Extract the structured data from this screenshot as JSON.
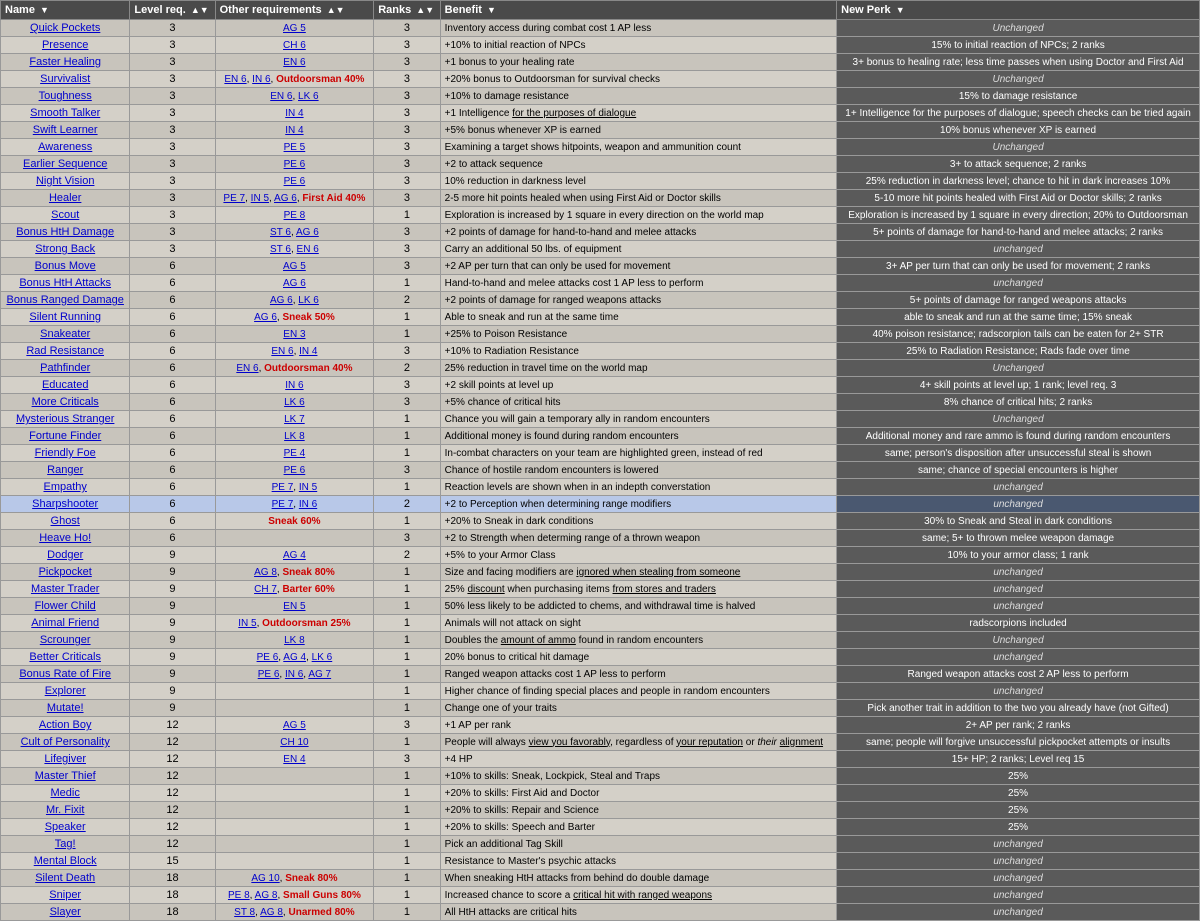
{
  "headers": [
    {
      "label": "Name",
      "key": "name"
    },
    {
      "label": "Level req.",
      "key": "level"
    },
    {
      "label": "Other requirements",
      "key": "other"
    },
    {
      "label": "Ranks",
      "key": "ranks"
    },
    {
      "label": "Benefit",
      "key": "benefit"
    },
    {
      "label": "New Perk",
      "key": "newperk"
    }
  ],
  "rows": [
    {
      "name": "Quick Pockets",
      "level": 3,
      "other": "AG 5",
      "other_raw": "AG 5",
      "ranks": 3,
      "benefit": "Inventory access during combat cost 1 AP less",
      "newperk": "Unchanged",
      "newperk_type": "unchanged"
    },
    {
      "name": "Presence",
      "level": 3,
      "other": "CH 6",
      "other_raw": "CH 6",
      "ranks": 3,
      "benefit": "+10% to initial reaction of NPCs",
      "newperk": "15% to initial reaction of NPCs; 2 ranks",
      "newperk_type": "changed"
    },
    {
      "name": "Faster Healing",
      "level": 3,
      "other": "EN 6",
      "other_raw": "EN 6",
      "ranks": 3,
      "benefit": "+1 bonus to your healing rate",
      "newperk": "3+ bonus to healing rate; less time passes when using Doctor and First Aid",
      "newperk_type": "changed"
    },
    {
      "name": "Survivalist",
      "level": 3,
      "other": "EN 6, IN 6, Outdoorsman 40%",
      "other_raw": "EN 6, IN 6, Outdoorsman 40%",
      "ranks": 3,
      "benefit": "+20% bonus to Outdoorsman for survival checks",
      "newperk": "Unchanged",
      "newperk_type": "unchanged"
    },
    {
      "name": "Toughness",
      "level": 3,
      "other": "EN 6, LK 6",
      "other_raw": "EN 6, LK 6",
      "ranks": 3,
      "benefit": "+10% to damage resistance",
      "newperk": "15% to damage resistance",
      "newperk_type": "changed"
    },
    {
      "name": "Smooth Talker",
      "level": 3,
      "other": "IN 4",
      "other_raw": "IN 4",
      "ranks": 3,
      "benefit": "+1 Intelligence for the purposes of dialogue",
      "newperk": "1+ Intelligence for the purposes of dialogue; speech checks can be tried again",
      "newperk_type": "changed"
    },
    {
      "name": "Swift Learner",
      "level": 3,
      "other": "IN 4",
      "other_raw": "IN 4",
      "ranks": 3,
      "benefit": "+5% bonus whenever XP is earned",
      "newperk": "10% bonus whenever XP is earned",
      "newperk_type": "changed"
    },
    {
      "name": "Awareness",
      "level": 3,
      "other": "PE 5",
      "other_raw": "PE 5",
      "ranks": 3,
      "benefit": "Examining a target shows hitpoints, weapon and ammunition count",
      "newperk": "",
      "newperk_type": "unchanged"
    },
    {
      "name": "Earlier Sequence",
      "level": 3,
      "other": "PE 6",
      "other_raw": "PE 6",
      "ranks": 3,
      "benefit": "+2 to attack sequence",
      "newperk": "3+ to attack sequence; 2 ranks",
      "newperk_type": "changed"
    },
    {
      "name": "Night Vision",
      "level": 3,
      "other": "PE 6",
      "other_raw": "PE 6",
      "ranks": 3,
      "benefit": "10% reduction in darkness level",
      "newperk": "25% reduction in darkness level; chance to hit in dark increases 10%",
      "newperk_type": "changed"
    },
    {
      "name": "Healer",
      "level": 3,
      "other": "PE 7, IN 5, AG 6, First Aid 40%",
      "other_raw": "PE 7, IN 5, AG 6, First Aid 40%",
      "ranks": 3,
      "benefit": "2-5 more hit points healed when using First Aid or Doctor skills",
      "newperk": "5-10 more hit points healed with First Aid or Doctor skills; 2 ranks",
      "newperk_type": "changed"
    },
    {
      "name": "Scout",
      "level": 3,
      "other": "PE 8",
      "other_raw": "PE 8",
      "ranks": 1,
      "benefit": "Exploration is increased by 1 square in every direction on the world map",
      "newperk": "Exploration is increased by 1 square in every direction; 20% to Outdoorsman",
      "newperk_type": "changed"
    },
    {
      "name": "Bonus HtH Damage",
      "level": 3,
      "other": "ST 6, AG 6",
      "other_raw": "ST 6, AG 6",
      "ranks": 3,
      "benefit": "+2 points of damage for hand-to-hand and melee attacks",
      "newperk": "5+ points of damage for hand-to-hand and melee attacks; 2 ranks",
      "newperk_type": "changed"
    },
    {
      "name": "Strong Back",
      "level": 3,
      "other": "ST 6, EN 6",
      "other_raw": "ST 6, EN 6",
      "ranks": 3,
      "benefit": "Carry an additional 50 lbs. of equipment",
      "newperk": "unchanged",
      "newperk_type": "unchanged"
    },
    {
      "name": "Bonus Move",
      "level": 6,
      "other": "AG 5",
      "other_raw": "AG 5",
      "ranks": 3,
      "benefit": "+2 AP per turn that can only be used for movement",
      "newperk": "3+ AP per turn that can only be used for movement; 2 ranks",
      "newperk_type": "changed"
    },
    {
      "name": "Bonus HtH Attacks",
      "level": 6,
      "other": "AG 6",
      "other_raw": "AG 6",
      "ranks": 1,
      "benefit": "Hand-to-hand and melee attacks cost 1 AP less to perform",
      "newperk": "unchanged",
      "newperk_type": "unchanged"
    },
    {
      "name": "Bonus Ranged Damage",
      "level": 6,
      "other": "AG 6, LK 6",
      "other_raw": "AG 6, LK 6",
      "ranks": 2,
      "benefit": "+2 points of damage for ranged weapons attacks",
      "newperk": "5+ points of damage for ranged weapons attacks",
      "newperk_type": "changed"
    },
    {
      "name": "Silent Running",
      "level": 6,
      "other": "AG 6, Sneak 50%",
      "other_raw": "AG 6, Sneak 50%",
      "ranks": 1,
      "benefit": "Able to sneak and run at the same time",
      "newperk": "able to sneak and run at the same time; 15% sneak",
      "newperk_type": "changed"
    },
    {
      "name": "Snakeater",
      "level": 6,
      "other": "EN 3",
      "other_raw": "EN 3",
      "ranks": 1,
      "benefit": "+25% to Poison Resistance",
      "newperk": "40% poison resistance; radscorpion tails can be eaten for 2+ STR",
      "newperk_type": "changed"
    },
    {
      "name": "Rad Resistance",
      "level": 6,
      "other": "EN 6, IN 4",
      "other_raw": "EN 6, IN 4",
      "ranks": 3,
      "benefit": "+10% to Radiation Resistance",
      "newperk": "25% to Radiation Resistance; Rads fade over time",
      "newperk_type": "changed"
    },
    {
      "name": "Pathfinder",
      "level": 6,
      "other": "EN 6, Outdoorsman 40%",
      "other_raw": "EN 6, Outdoorsman 40%",
      "ranks": 2,
      "benefit": "25% reduction in travel time on the world map",
      "newperk": "Unchanged",
      "newperk_type": "unchanged"
    },
    {
      "name": "Educated",
      "level": 6,
      "other": "IN 6",
      "other_raw": "IN 6",
      "ranks": 3,
      "benefit": "+2 skill points at level up",
      "newperk": "4+ skill points at level up; 1 rank; level req. 3",
      "newperk_type": "changed"
    },
    {
      "name": "More Criticals",
      "level": 6,
      "other": "LK 6",
      "other_raw": "LK 6",
      "ranks": 3,
      "benefit": "+5% chance of critical hits",
      "newperk": "8% chance of critical hits; 2 ranks",
      "newperk_type": "changed"
    },
    {
      "name": "Mysterious Stranger",
      "level": 6,
      "other": "LK 7",
      "other_raw": "LK 7",
      "ranks": 1,
      "benefit": "Chance you will gain a temporary ally in random encounters",
      "newperk": "Unchanged",
      "newperk_type": "unchanged"
    },
    {
      "name": "Fortune Finder",
      "level": 6,
      "other": "LK 8",
      "other_raw": "LK 8",
      "ranks": 1,
      "benefit": "Additional money is found during random encounters",
      "newperk": "Additional money and rare ammo is found during random encounters",
      "newperk_type": "changed"
    },
    {
      "name": "Friendly Foe",
      "level": 6,
      "other": "PE 4",
      "other_raw": "PE 4",
      "ranks": 1,
      "benefit": "In-combat characters on your team are highlighted green, instead of red",
      "newperk": "same; person's disposition after unsuccessful steal is shown",
      "newperk_type": "changed"
    },
    {
      "name": "Ranger",
      "level": 6,
      "other": "PE 6",
      "other_raw": "PE 6",
      "ranks": 3,
      "benefit": "Chance of hostile random encounters is lowered",
      "newperk": "same; chance of special encounters is higher",
      "newperk_type": "changed"
    },
    {
      "name": "Empathy",
      "level": 6,
      "other": "PE 7, IN 5",
      "other_raw": "PE 7, IN 5",
      "ranks": 1,
      "benefit": "Reaction levels are shown when in an indepth converstation",
      "newperk": "unchanged",
      "newperk_type": "unchanged"
    },
    {
      "name": "Sharpshooter",
      "level": 6,
      "other": "PE 7, IN 6",
      "other_raw": "PE 7, IN 6",
      "ranks": 2,
      "benefit": "+2 to Perception when determining range modifiers",
      "newperk": "unchanged",
      "newperk_type": "unchanged",
      "selected": true
    },
    {
      "name": "Ghost",
      "level": 6,
      "other": "Sneak 60%",
      "other_raw": "Sneak 60%",
      "ranks": 1,
      "benefit": "+20% to Sneak in dark conditions",
      "newperk": "30% to Sneak and Steal in dark conditions",
      "newperk_type": "changed"
    },
    {
      "name": "Heave Ho!",
      "level": 6,
      "other": "",
      "other_raw": "",
      "ranks": 3,
      "benefit": "+2 to Strength when determing range of a thrown weapon",
      "newperk": "same; 5+ to thrown melee weapon damage",
      "newperk_type": "changed"
    },
    {
      "name": "Dodger",
      "level": 9,
      "other": "AG 4",
      "other_raw": "AG 4",
      "ranks": 2,
      "benefit": "+5% to your Armor Class",
      "newperk": "10% to your armor class; 1 rank",
      "newperk_type": "changed"
    },
    {
      "name": "Pickpocket",
      "level": 9,
      "other": "AG 8, Sneak 80%",
      "other_raw": "AG 8, Sneak 80%",
      "ranks": 1,
      "benefit": "Size and facing modifiers are ignored when stealing from someone",
      "newperk": "unchanged",
      "newperk_type": "unchanged"
    },
    {
      "name": "Master Trader",
      "level": 9,
      "other": "CH 7, Barter 60%",
      "other_raw": "CH 7, Barter 60%",
      "ranks": 1,
      "benefit": "25% discount when purchasing items from stores and traders",
      "newperk": "unchanged",
      "newperk_type": "unchanged"
    },
    {
      "name": "Flower Child",
      "level": 9,
      "other": "EN 5",
      "other_raw": "EN 5",
      "ranks": 1,
      "benefit": "50% less likely to be addicted to chems, and withdrawal time is halved",
      "newperk": "unchanged",
      "newperk_type": "unchanged"
    },
    {
      "name": "Animal Friend",
      "level": 9,
      "other": "IN 5, Outdoorsman 25%",
      "other_raw": "IN 5, Outdoorsman 25%",
      "ranks": 1,
      "benefit": "Animals will not attack on sight",
      "newperk": "radscorpions included",
      "newperk_type": "changed"
    },
    {
      "name": "Scrounger",
      "level": 9,
      "other": "LK 8",
      "other_raw": "LK 8",
      "ranks": 1,
      "benefit": "Doubles the amount of ammo found in random encounters",
      "newperk": "Unchanged",
      "newperk_type": "unchanged"
    },
    {
      "name": "Better Criticals",
      "level": 9,
      "other": "PE 6, AG 4, LK 6",
      "other_raw": "PE 6, AG 4, LK 6",
      "ranks": 1,
      "benefit": "20% bonus to critical hit damage",
      "newperk": "unchanged",
      "newperk_type": "unchanged"
    },
    {
      "name": "Bonus Rate of Fire",
      "level": 9,
      "other": "PE 6, IN 6, AG 7",
      "other_raw": "PE 6, IN 6, AG 7",
      "ranks": 1,
      "benefit": "Ranged weapon attacks cost 1 AP less to perform",
      "newperk": "Ranged weapon attacks cost 2 AP less to perform",
      "newperk_type": "changed"
    },
    {
      "name": "Explorer",
      "level": 9,
      "other": "",
      "other_raw": "",
      "ranks": 1,
      "benefit": "Higher chance of finding special places and people in random encounters",
      "newperk": "unchanged",
      "newperk_type": "unchanged"
    },
    {
      "name": "Mutate!",
      "level": 9,
      "other": "",
      "other_raw": "",
      "ranks": 1,
      "benefit": "Change one of your traits",
      "newperk": "Pick another trait in addition to the two you already have (not Gifted)",
      "newperk_type": "changed"
    },
    {
      "name": "Action Boy",
      "level": 12,
      "other": "AG 5",
      "other_raw": "AG 5",
      "ranks": 3,
      "benefit": "+1 AP per rank",
      "newperk": "2+ AP per rank; 2 ranks",
      "newperk_type": "changed"
    },
    {
      "name": "Cult of Personality",
      "level": 12,
      "other": "CH 10",
      "other_raw": "CH 10",
      "ranks": 1,
      "benefit": "People will always view you favorably, regardless of your reputation or their alignment",
      "newperk": "same; people will forgive unsuccessful pickpocket attempts or insults",
      "newperk_type": "changed"
    },
    {
      "name": "Lifegiver",
      "level": 12,
      "other": "EN 4",
      "other_raw": "EN 4",
      "ranks": 3,
      "benefit": "+4 HP",
      "newperk": "15+ HP; 2 ranks; Level req 15",
      "newperk_type": "changed"
    },
    {
      "name": "Master Thief",
      "level": 12,
      "other": "",
      "other_raw": "",
      "ranks": 1,
      "benefit": "+10% to skills: Sneak, Lockpick, Steal and Traps",
      "newperk": "25%",
      "newperk_type": "changed"
    },
    {
      "name": "Medic",
      "level": 12,
      "other": "",
      "other_raw": "",
      "ranks": 1,
      "benefit": "+20% to skills: First Aid and Doctor",
      "newperk": "25%",
      "newperk_type": "changed"
    },
    {
      "name": "Mr. Fixit",
      "level": 12,
      "other": "",
      "other_raw": "",
      "ranks": 1,
      "benefit": "+20% to skills: Repair and Science",
      "newperk": "25%",
      "newperk_type": "changed"
    },
    {
      "name": "Speaker",
      "level": 12,
      "other": "",
      "other_raw": "",
      "ranks": 1,
      "benefit": "+20% to skills: Speech and Barter",
      "newperk": "25%",
      "newperk_type": "changed"
    },
    {
      "name": "Tag!",
      "level": 12,
      "other": "",
      "other_raw": "",
      "ranks": 1,
      "benefit": "Pick an additional Tag Skill",
      "newperk": "unchanged",
      "newperk_type": "unchanged"
    },
    {
      "name": "Mental Block",
      "level": 15,
      "other": "",
      "other_raw": "",
      "ranks": 1,
      "benefit": "Resistance to Master's psychic attacks",
      "newperk": "unchanged",
      "newperk_type": "unchanged"
    },
    {
      "name": "Silent Death",
      "level": 18,
      "other": "AG 10, Sneak 80%",
      "other_raw": "AG 10, Sneak 80%",
      "ranks": 1,
      "benefit": "When sneaking HtH attacks from behind do double damage",
      "newperk": "unchanged",
      "newperk_type": "unchanged"
    },
    {
      "name": "Sniper",
      "level": 18,
      "other": "PE 8, AG 8, Small Guns 80%",
      "other_raw": "PE 8, AG 8, Small Guns 80%",
      "ranks": 1,
      "benefit": "Increased chance to score a critical hit with ranged weapons",
      "newperk": "unchanged",
      "newperk_type": "unchanged"
    },
    {
      "name": "Slayer",
      "level": 18,
      "other": "ST 8, AG 8, Unarmed 80%",
      "other_raw": "ST 8, AG 8, Unarmed 80%",
      "ranks": 1,
      "benefit": "All HtH attacks are critical hits",
      "newperk": "unchanged",
      "newperk_type": "unchanged"
    }
  ]
}
